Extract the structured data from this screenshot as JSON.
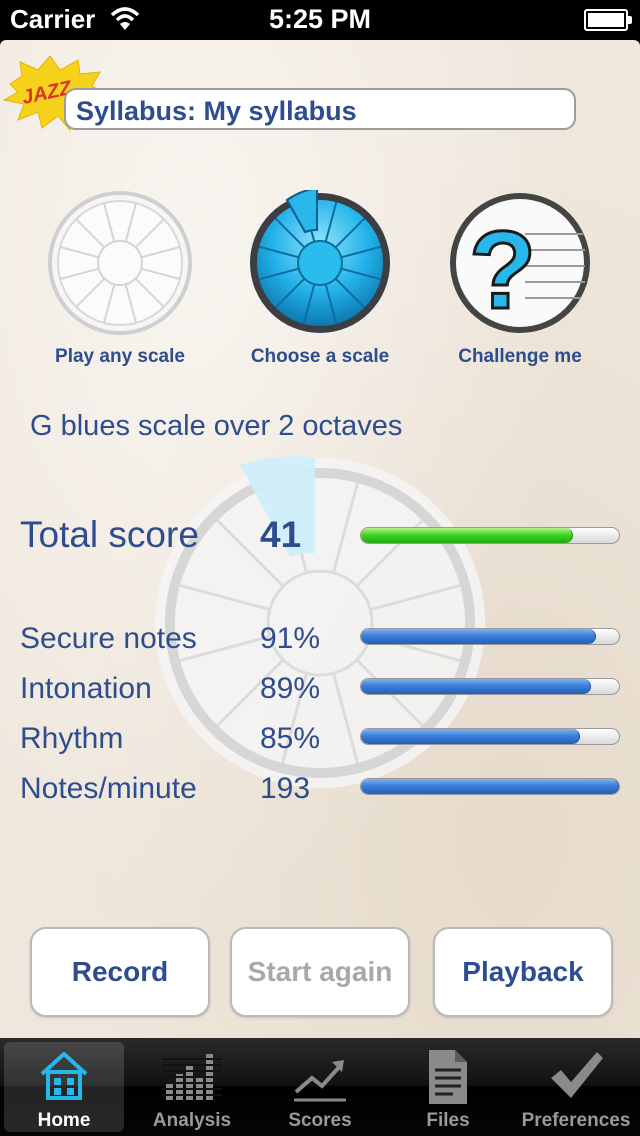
{
  "status_bar": {
    "carrier": "Carrier",
    "time": "5:25 PM"
  },
  "header": {
    "logo_text": "JAZZ",
    "syllabus": "Syllabus: My syllabus"
  },
  "modes": [
    {
      "label": "Play any scale",
      "icon": "wheel-grey-icon"
    },
    {
      "label": "Choose a scale",
      "icon": "wheel-blue-icon"
    },
    {
      "label": "Challenge me",
      "icon": "question-staff-icon"
    }
  ],
  "scale_title": "G blues scale over 2 octaves",
  "total": {
    "label": "Total score",
    "value": "41",
    "progress": 0.82
  },
  "metrics": [
    {
      "label": "Secure notes",
      "value": "91%",
      "progress": 0.91
    },
    {
      "label": "Intonation",
      "value": "89%",
      "progress": 0.89
    },
    {
      "label": "Rhythm",
      "value": "85%",
      "progress": 0.85
    },
    {
      "label": "Notes/minute",
      "value": "193",
      "progress": 1.0
    }
  ],
  "buttons": {
    "record": "Record",
    "start_again": "Start again",
    "playback": "Playback"
  },
  "tabs": [
    {
      "label": "Home",
      "icon": "home-icon",
      "active": true
    },
    {
      "label": "Analysis",
      "icon": "bars-icon"
    },
    {
      "label": "Scores",
      "icon": "line-chart-icon"
    },
    {
      "label": "Files",
      "icon": "document-icon"
    },
    {
      "label": "Preferences",
      "icon": "checkmark-icon"
    }
  ],
  "colors": {
    "text_blue": "#2e4d8e",
    "accent_cyan": "#27b7ea",
    "green_bar": "#39d21c",
    "blue_bar": "#3c7fd9"
  }
}
